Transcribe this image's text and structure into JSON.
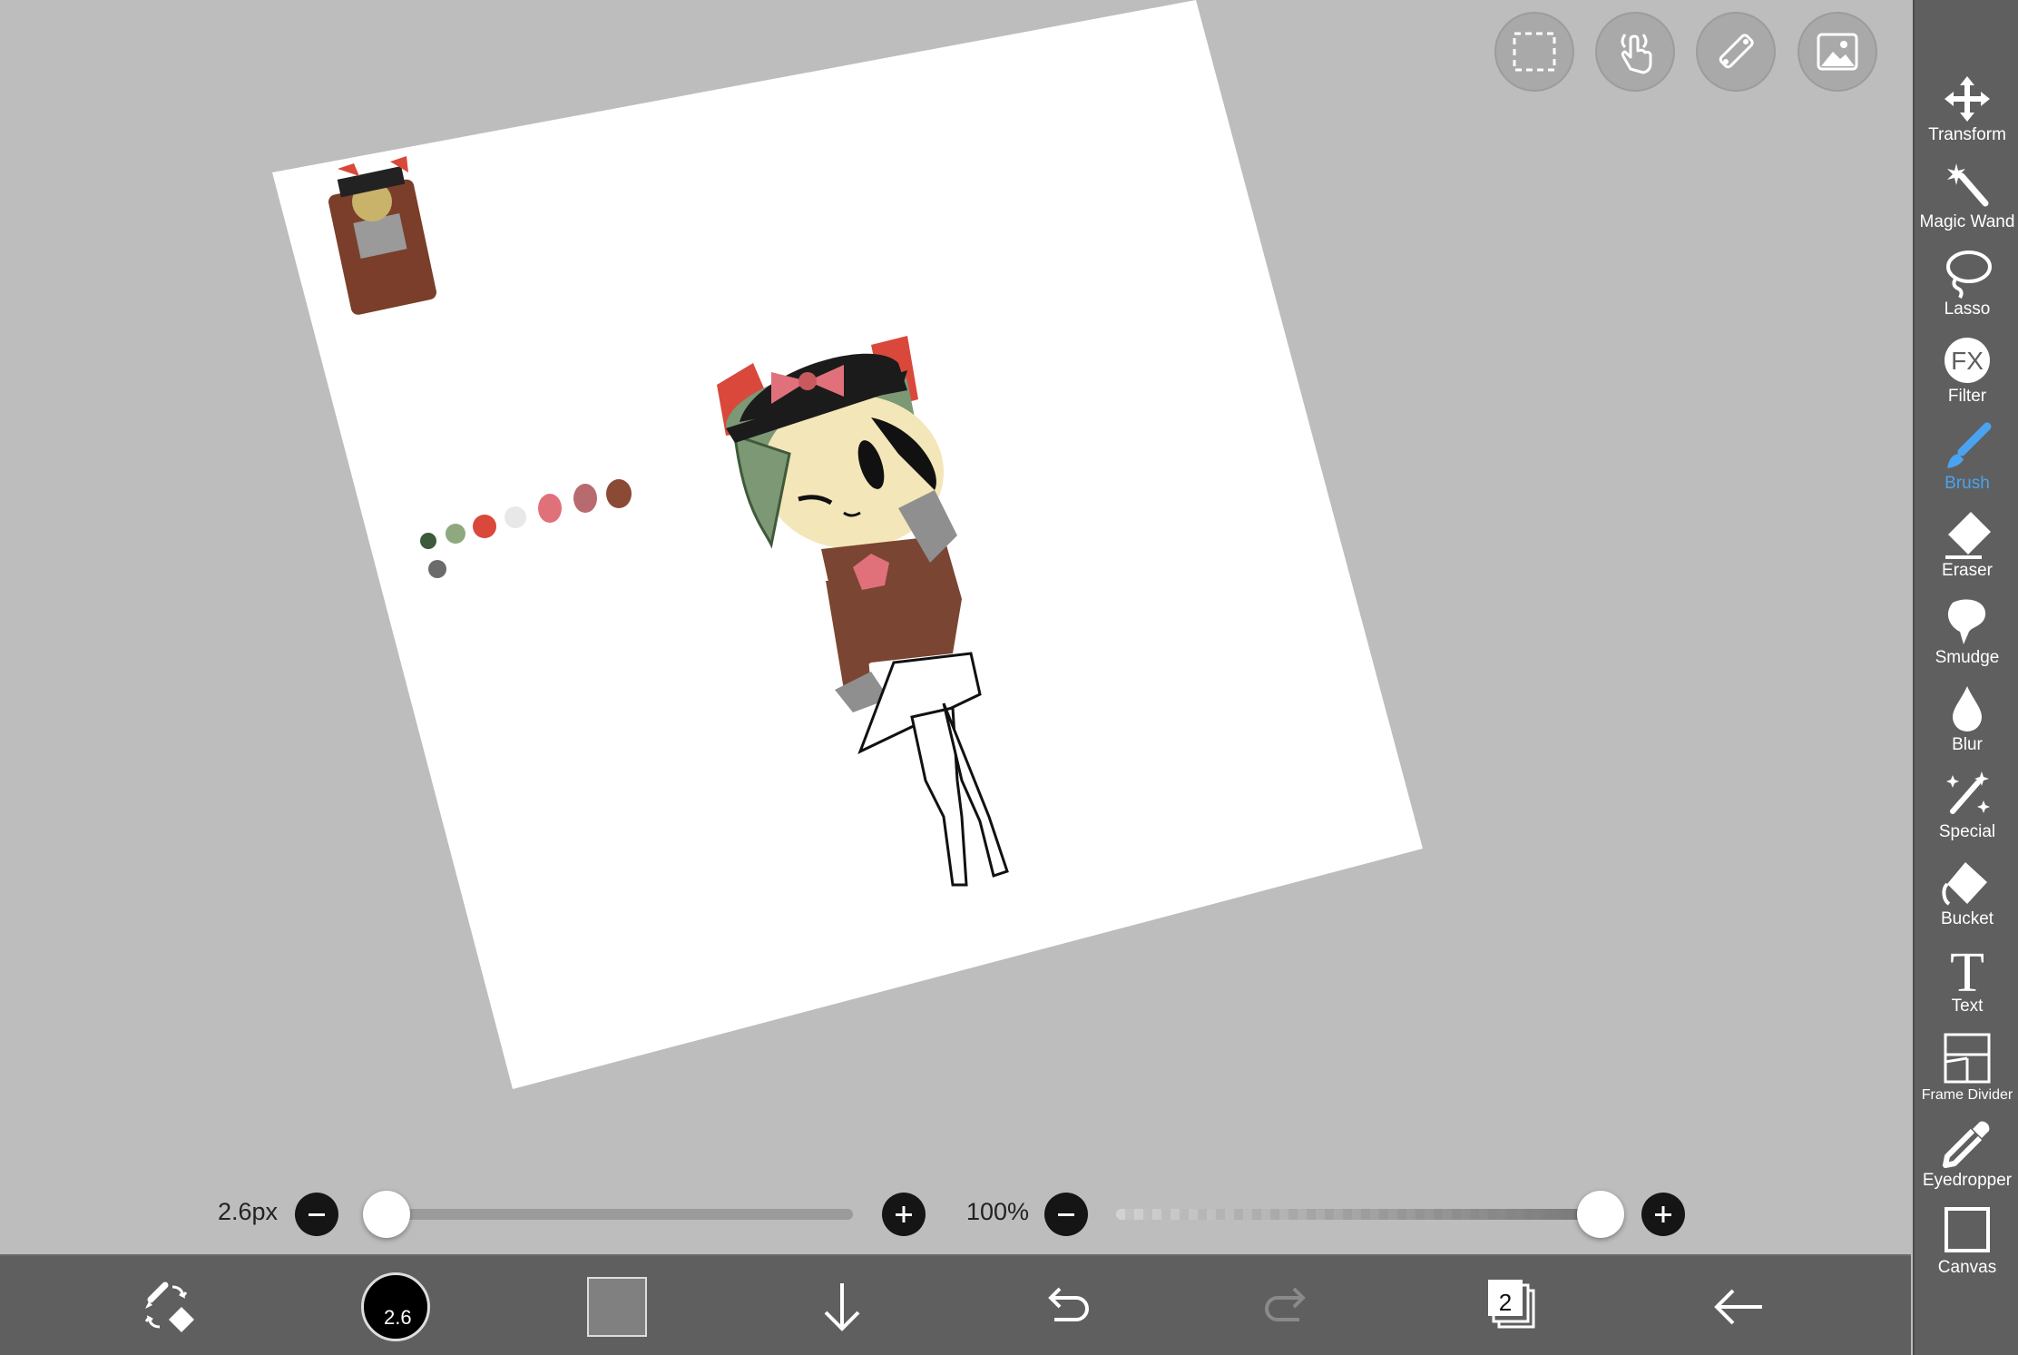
{
  "toolbar_top": {
    "buttons": [
      {
        "name": "selection-icon"
      },
      {
        "name": "touch-gesture-icon"
      },
      {
        "name": "ruler-icon"
      },
      {
        "name": "image-import-icon"
      }
    ]
  },
  "tools": [
    {
      "label": "Transform",
      "icon": "move-arrows-icon"
    },
    {
      "label": "Magic Wand",
      "icon": "magic-wand-icon"
    },
    {
      "label": "Lasso",
      "icon": "lasso-icon"
    },
    {
      "label": "Filter",
      "icon": "fx-icon",
      "icon_text": "FX"
    },
    {
      "label": "Brush",
      "icon": "brush-icon",
      "active": true
    },
    {
      "label": "Eraser",
      "icon": "eraser-icon"
    },
    {
      "label": "Smudge",
      "icon": "smudge-icon"
    },
    {
      "label": "Blur",
      "icon": "blur-drop-icon"
    },
    {
      "label": "Special",
      "icon": "special-sparkle-icon"
    },
    {
      "label": "Bucket",
      "icon": "bucket-icon"
    },
    {
      "label": "Text",
      "icon": "text-icon",
      "icon_text": "T"
    },
    {
      "label": "Frame Divider",
      "icon": "frame-divider-icon"
    },
    {
      "label": "Eyedropper",
      "icon": "eyedropper-icon"
    },
    {
      "label": "Canvas",
      "icon": "canvas-icon"
    }
  ],
  "brush_size": {
    "label": "2.6px",
    "value": 0.04
  },
  "opacity": {
    "label": "100%",
    "value": 1.0
  },
  "bottom_bar": {
    "brush_preview_label": "2.6",
    "secondary_color": "#808080",
    "layer_count": "2"
  },
  "colors": {
    "panel": "#5f5f5f",
    "active_tool": "#4aa3f0",
    "background": "#bdbdbd",
    "palette": [
      "#3d5a3a",
      "#8fa97e",
      "#d9483b",
      "#e8e8e8",
      "#e0717a",
      "#b86b6f",
      "#8b4a35",
      "#6b6b6b"
    ]
  }
}
